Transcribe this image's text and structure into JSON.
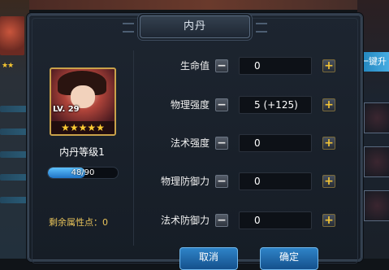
{
  "panel": {
    "title": "内丹"
  },
  "hero": {
    "level_badge": "LV. 29",
    "stars": "★★★★★",
    "level_label": "内丹等级1",
    "exp": {
      "text": "48/90",
      "current": 48,
      "max": 90
    },
    "remaining_points": "剩余属性点：0"
  },
  "attributes": [
    {
      "label": "生命值",
      "value": "0"
    },
    {
      "label": "物理强度",
      "value": "5 (+125)"
    },
    {
      "label": "法术强度",
      "value": "0"
    },
    {
      "label": "物理防御力",
      "value": "0"
    },
    {
      "label": "法术防御力",
      "value": "0"
    }
  ],
  "buttons": {
    "minus": "−",
    "plus": "+",
    "cancel": "取消",
    "confirm": "确定"
  },
  "background": {
    "left_stars": "★★",
    "onekey_label": "一键升"
  },
  "colors": {
    "accent_gold": "#f4c535",
    "button_blue": "#2f84c8",
    "remaining_text": "#e8c35a"
  }
}
